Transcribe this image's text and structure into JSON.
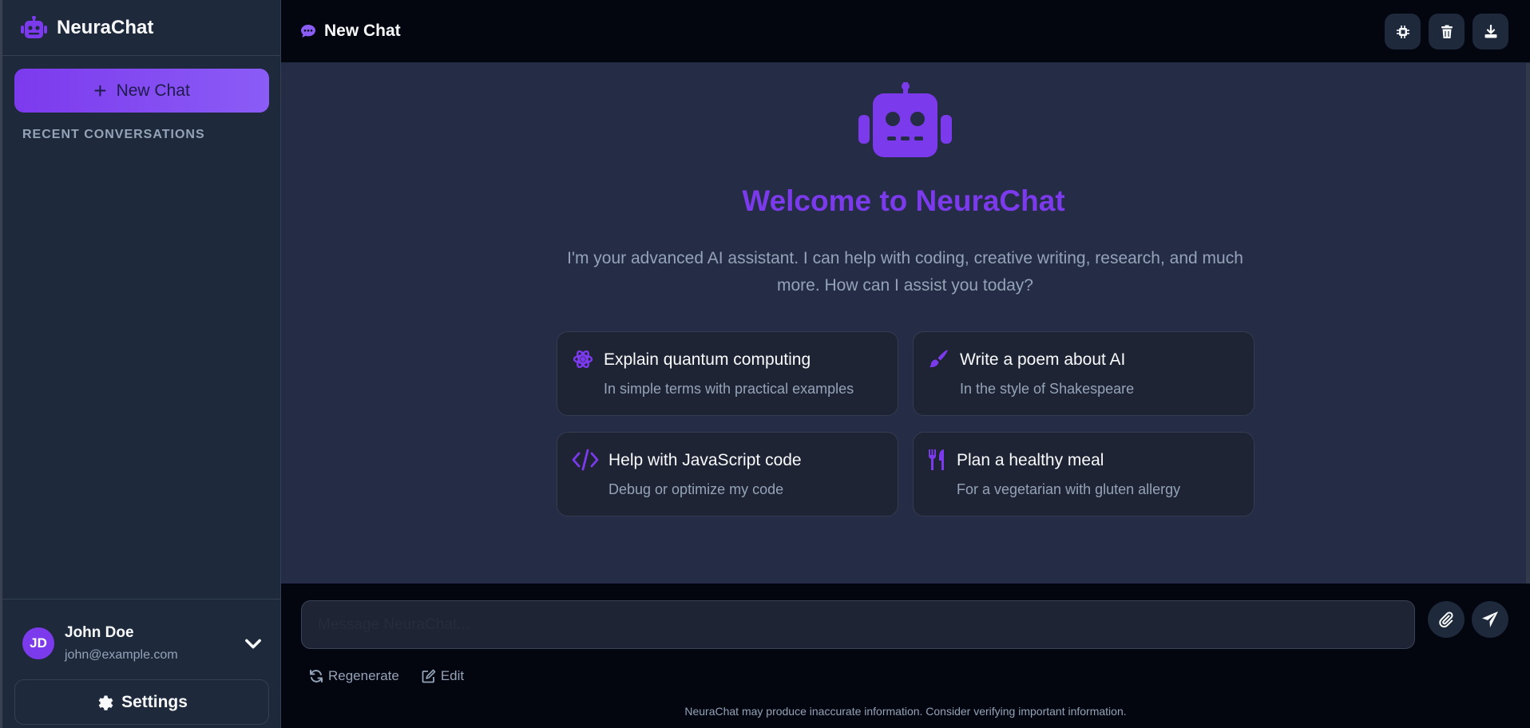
{
  "app": {
    "name": "NeuraChat",
    "accent": "#7c3aed"
  },
  "sidebar": {
    "new_chat_label": "New Chat",
    "recent_label": "RECENT CONVERSATIONS",
    "user": {
      "initials": "JD",
      "name": "John Doe",
      "email": "john@example.com"
    },
    "settings_label": "Settings"
  },
  "header": {
    "title": "New Chat",
    "actions": [
      {
        "icon": "chip-icon"
      },
      {
        "icon": "trash-icon"
      },
      {
        "icon": "download-icon"
      }
    ]
  },
  "welcome": {
    "title": "Welcome to NeuraChat",
    "intro": "I'm your advanced AI assistant. I can help with coding, creative writing, research, and much more. How can I assist you today?",
    "suggestions": [
      {
        "icon": "atom-icon",
        "title": "Explain quantum computing",
        "subtitle": "In simple terms with practical examples"
      },
      {
        "icon": "brush-icon",
        "title": "Write a poem about AI",
        "subtitle": "In the style of Shakespeare"
      },
      {
        "icon": "code-icon",
        "title": "Help with JavaScript code",
        "subtitle": "Debug or optimize my code"
      },
      {
        "icon": "utensils-icon",
        "title": "Plan a healthy meal",
        "subtitle": "For a vegetarian with gluten allergy"
      }
    ]
  },
  "composer": {
    "placeholder": "Message NeuraChat...",
    "regenerate_label": "Regenerate",
    "edit_label": "Edit",
    "disclaimer": "NeuraChat may produce inaccurate information. Consider verifying important information."
  }
}
